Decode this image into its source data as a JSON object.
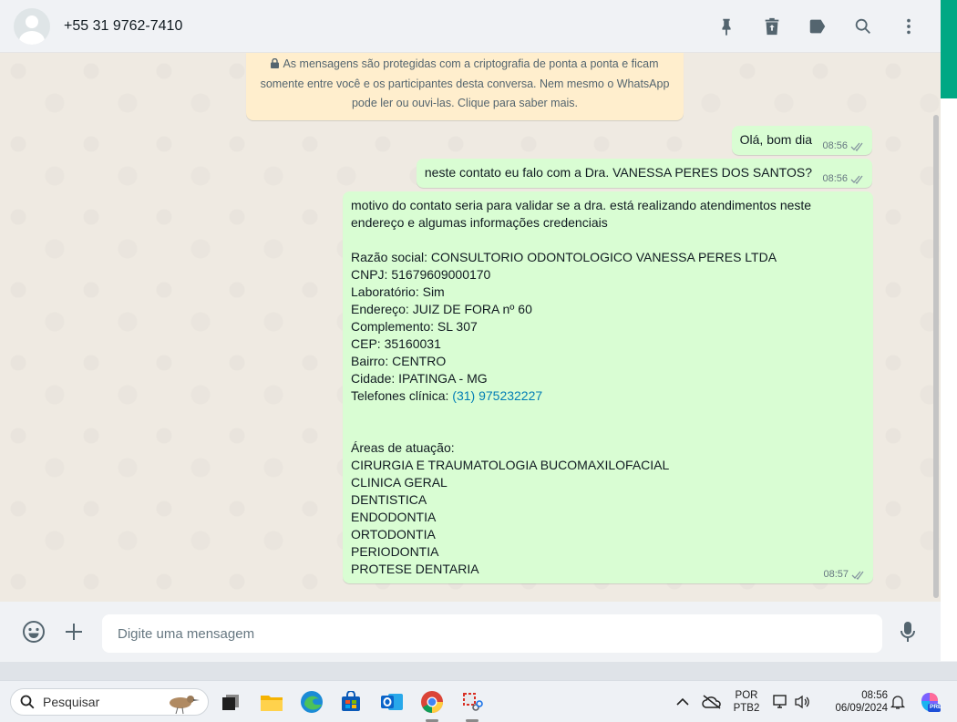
{
  "header": {
    "contact": "+55 31 9762-7410",
    "icons": [
      "pin-icon",
      "delete-icon",
      "label-icon",
      "search-icon",
      "menu-icon"
    ]
  },
  "notice": {
    "text": "As mensagens são protegidas com a criptografia de ponta a ponta e ficam somente entre você e os participantes desta conversa. Nem mesmo o WhatsApp pode ler ou ouvi-las. Clique para saber mais."
  },
  "messages": [
    {
      "text": "Olá, bom dia",
      "time": "08:56"
    },
    {
      "text": "neste contato eu falo com a Dra. VANESSA PERES DOS SANTOS?",
      "time": "08:56"
    },
    {
      "text_before_link": "motivo do contato seria para validar se a dra. está realizando atendimentos neste endereço e algumas informações credenciais\n\nRazão social: CONSULTORIO ODONTOLOGICO VANESSA PERES LTDA\nCNPJ: 51679609000170\nLaboratório: Sim\nEndereço: JUIZ DE FORA nº 60\nComplemento: SL 307\nCEP: 35160031\nBairro: CENTRO\nCidade: IPATINGA - MG\nTelefones clínica: ",
      "link": "(31) 975232227",
      "text_after_link": "\n\n\nÁreas de atuação:\nCIRURGIA E TRAUMATOLOGIA BUCOMAXILOFACIAL\nCLINICA GERAL\nDENTISTICA\nENDODONTIA\nORTODONTIA\nPERIODONTIA\nPROTESE DENTARIA",
      "time": "08:57"
    }
  ],
  "composer": {
    "placeholder": "Digite uma mensagem"
  },
  "taskbar": {
    "search_label": "Pesquisar",
    "lang_line1": "POR",
    "lang_line2": "PTB2",
    "time": "08:56",
    "date": "06/09/2024",
    "copilot_badge": "PRE"
  },
  "colors": {
    "bubble": "#d9fdd3",
    "accent": "#00a884",
    "notice": "#ffeecd",
    "link": "#027eb5"
  }
}
